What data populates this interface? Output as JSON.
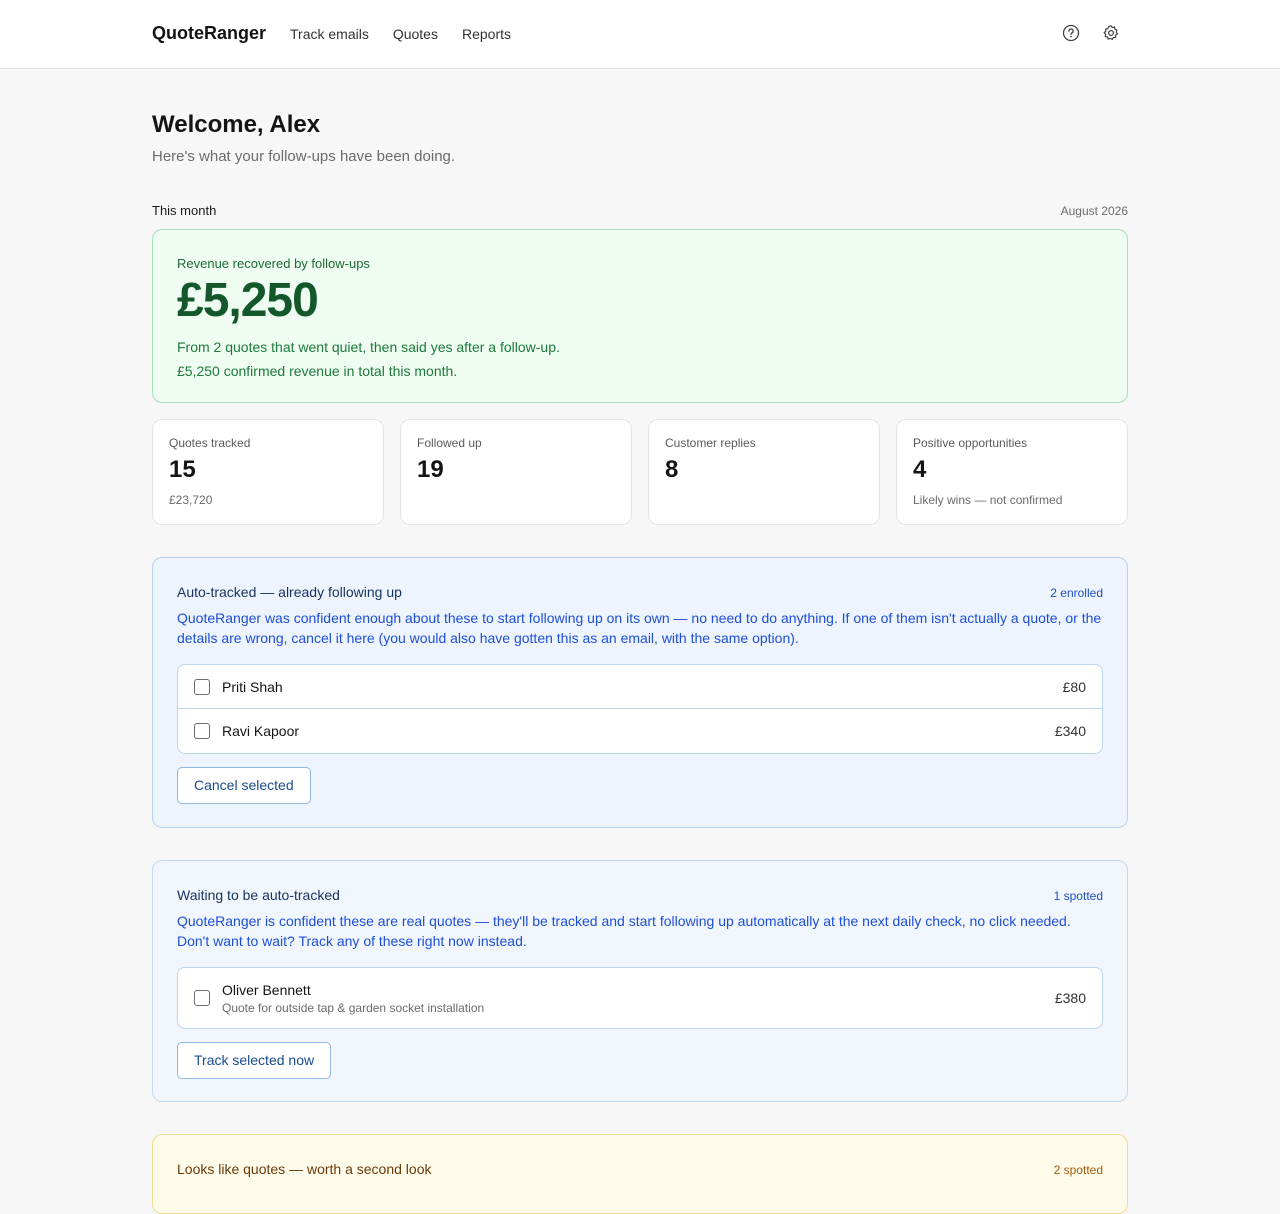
{
  "app": {
    "brand": "QuoteRanger"
  },
  "nav": {
    "items": [
      "Track emails",
      "Quotes",
      "Reports"
    ]
  },
  "header": {
    "title": "Welcome, Alex",
    "subtitle": "Here's what your follow-ups have been doing."
  },
  "month": {
    "label": "This month",
    "date": "August 2026"
  },
  "revenue": {
    "title": "Revenue recovered by follow-ups",
    "amount": "£5,250",
    "line1": "From 2 quotes that went quiet, then said yes after a follow-up.",
    "line2": "£5,250 confirmed revenue in total this month."
  },
  "stats": [
    {
      "label": "Quotes tracked",
      "value": "15",
      "note": "£23,720"
    },
    {
      "label": "Followed up",
      "value": "19",
      "note": ""
    },
    {
      "label": "Customer replies",
      "value": "8",
      "note": ""
    },
    {
      "label": "Positive opportunities",
      "value": "4",
      "note": "Likely wins — not confirmed"
    }
  ],
  "auto_tracked": {
    "title": "Auto-tracked — already following up",
    "count": "2 enrolled",
    "desc": "QuoteRanger was confident enough about these to start following up on its own — no need to do anything. If one of them isn't actually a quote, or the details are wrong, cancel it here (you would also have gotten this as an email, with the same option).",
    "rows": [
      {
        "name": "Priti Shah",
        "amount": "£80"
      },
      {
        "name": "Ravi Kapoor",
        "amount": "£340"
      }
    ],
    "button": "Cancel selected"
  },
  "waiting": {
    "title": "Waiting to be auto-tracked",
    "count": "1 spotted",
    "desc": "QuoteRanger is confident these are real quotes — they'll be tracked and start following up automatically at the next daily check, no click needed. Don't want to wait? Track any of these right now instead.",
    "rows": [
      {
        "name": "Oliver Bennett",
        "desc": "Quote for outside tap & garden socket installation",
        "amount": "£380"
      }
    ],
    "button": "Track selected now"
  },
  "second_look": {
    "title": "Looks like quotes — worth a second look",
    "count": "2 spotted"
  },
  "icons": {
    "help": "help-circle-icon",
    "settings": "gear-icon"
  },
  "colors": {
    "green_bg": "#effcf2",
    "blue_bg": "#eef4fe",
    "amber_bg": "#fffbeb",
    "accent_blue": "#1d4fd6"
  }
}
